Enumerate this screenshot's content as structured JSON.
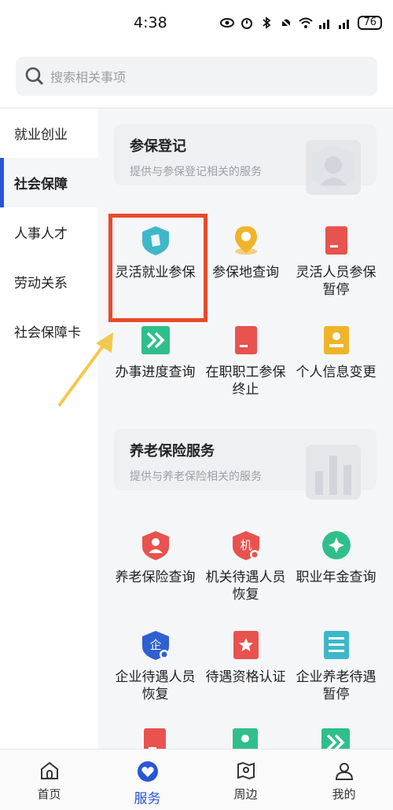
{
  "status_bar": {
    "time": "4:38",
    "battery": "76"
  },
  "search": {
    "placeholder": "搜索相关事项"
  },
  "sidebar": {
    "items": [
      {
        "label": "就业创业"
      },
      {
        "label": "社会保障"
      },
      {
        "label": "人事人才"
      },
      {
        "label": "劳动关系"
      },
      {
        "label": "社会保障卡"
      }
    ]
  },
  "section1": {
    "title": "参保登记",
    "subtitle": "提供与参保登记相关的服务",
    "items": [
      {
        "label": "灵活就业参保",
        "icon": "shield-icon"
      },
      {
        "label": "参保地查询",
        "icon": "location-pin-icon"
      },
      {
        "label": "灵活人员参保暂停",
        "icon": "document-icon"
      },
      {
        "label": "办事进度查询",
        "icon": "double-chevron-icon"
      },
      {
        "label": "在职职工参保终止",
        "icon": "document-icon"
      },
      {
        "label": "个人信息变更",
        "icon": "person-card-icon"
      }
    ]
  },
  "section2": {
    "title": "养老保险服务",
    "subtitle": "提供与养老保险相关的服务",
    "items": [
      {
        "label": "养老保险查询",
        "icon": "shield-person-icon"
      },
      {
        "label": "机关待遇人员恢复",
        "icon": "shield-ji-icon"
      },
      {
        "label": "职业年金查询",
        "icon": "star-circle-icon"
      },
      {
        "label": "企业待遇人员恢复",
        "icon": "shield-qi-icon"
      },
      {
        "label": "待遇资格认证",
        "icon": "star-card-icon"
      },
      {
        "label": "企业养老待遇暂停",
        "icon": "list-doc-icon"
      }
    ]
  },
  "bottom_nav": {
    "items": [
      {
        "label": "首页"
      },
      {
        "label": "服务"
      },
      {
        "label": "周边"
      },
      {
        "label": "我的"
      }
    ]
  },
  "colors": {
    "accent": "#2a55d8",
    "highlight": "#e84a2b",
    "arrow": "#f2c94c",
    "red_icon": "#e8534f",
    "teal_icon": "#3fb7c9",
    "green_icon": "#2fbf8a",
    "yellow_icon": "#f0b42b",
    "blue_icon": "#2f5fd0"
  }
}
